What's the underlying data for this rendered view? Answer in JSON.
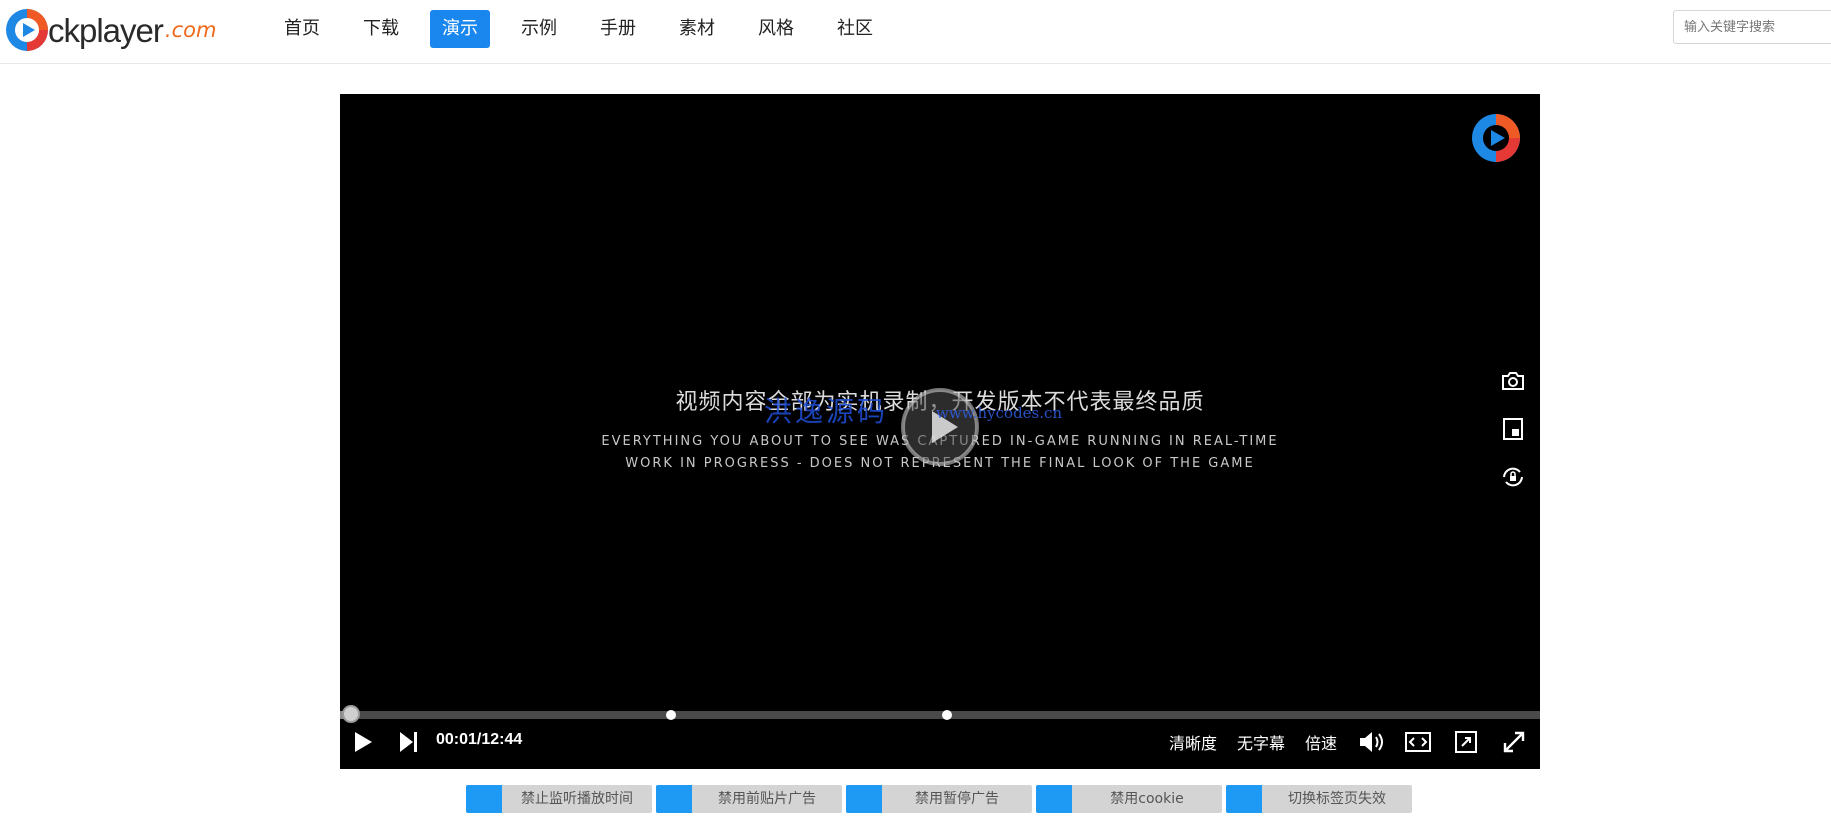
{
  "header": {
    "logo_text": "ckplayer",
    "logo_domain": ".com",
    "nav": [
      {
        "label": "首页",
        "active": false
      },
      {
        "label": "下载",
        "active": false
      },
      {
        "label": "演示",
        "active": true
      },
      {
        "label": "示例",
        "active": false
      },
      {
        "label": "手册",
        "active": false
      },
      {
        "label": "素材",
        "active": false
      },
      {
        "label": "风格",
        "active": false
      },
      {
        "label": "社区",
        "active": false
      }
    ],
    "search_placeholder": "输入关键字搜索"
  },
  "player": {
    "title_cn": "视频内容全部为实机录制，开发版本不代表最终品质",
    "title_en_line1": "EVERYTHING YOU ABOUT TO SEE WAS CAPTURED IN-GAME RUNNING IN REAL-TIME",
    "title_en_line2": "WORK IN PROGRESS - DOES NOT REPRESENT THE FINAL LOOK OF THE GAME",
    "watermark_cn": "洪逸源码",
    "watermark_url": "www.hycodes.cn",
    "time_display": "00:01/12:44",
    "progress_fraction": 0.0013,
    "buffered_fraction": 0.015,
    "markers_fraction": [
      0.276,
      0.506
    ],
    "controls": {
      "quality_label": "清晰度",
      "subtitle_label": "无字幕",
      "speed_label": "倍速"
    }
  },
  "options": [
    {
      "label": "禁止监听播放时间"
    },
    {
      "label": "禁用前贴片广告"
    },
    {
      "label": "禁用暂停广告"
    },
    {
      "label": "禁用cookie"
    },
    {
      "label": "切换标签页失效"
    }
  ],
  "colors": {
    "accent": "#1a87ee",
    "toggle": "#1e9af4",
    "logo_orange": "#f06a1c"
  }
}
